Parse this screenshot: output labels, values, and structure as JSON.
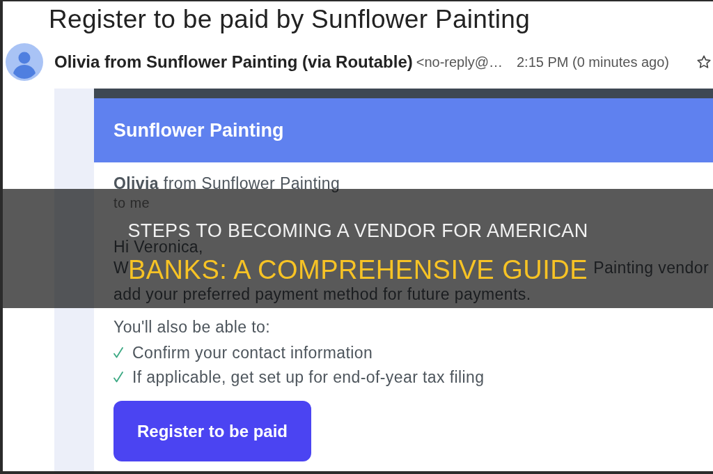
{
  "email": {
    "subject": "Register to be paid by Sunflower Painting",
    "sender": {
      "name": "Olivia from Sunflower Painting (via Routable)",
      "address": "<no-reply@…",
      "time": "2:15 PM (0 minutes ago)",
      "starred": false
    }
  },
  "message": {
    "header_title": "Sunflower Painting",
    "from_line": "**Olivia** from Sunflower Painting",
    "to_line": "to me",
    "greeting": "Hi Veronica,",
    "body_line_1": {
      "start": "W",
      "end": "Painting vendor"
    },
    "body_line_2": "add your preferred payment method for future payments.",
    "list_intro": "You'll also be able to:",
    "checklist": [
      "Confirm your contact information",
      "If applicable, get set up for end-of-year tax filing"
    ],
    "button": "Register to be paid"
  },
  "overlay": {
    "title_lines": [
      {
        "kind": "plain",
        "text": "STEPS TO BECOMING A VENDOR FOR AMERICAN"
      },
      {
        "kind": "highlight",
        "text": "BANKS: A COMPREHENSIVE GUIDE"
      }
    ]
  }
}
